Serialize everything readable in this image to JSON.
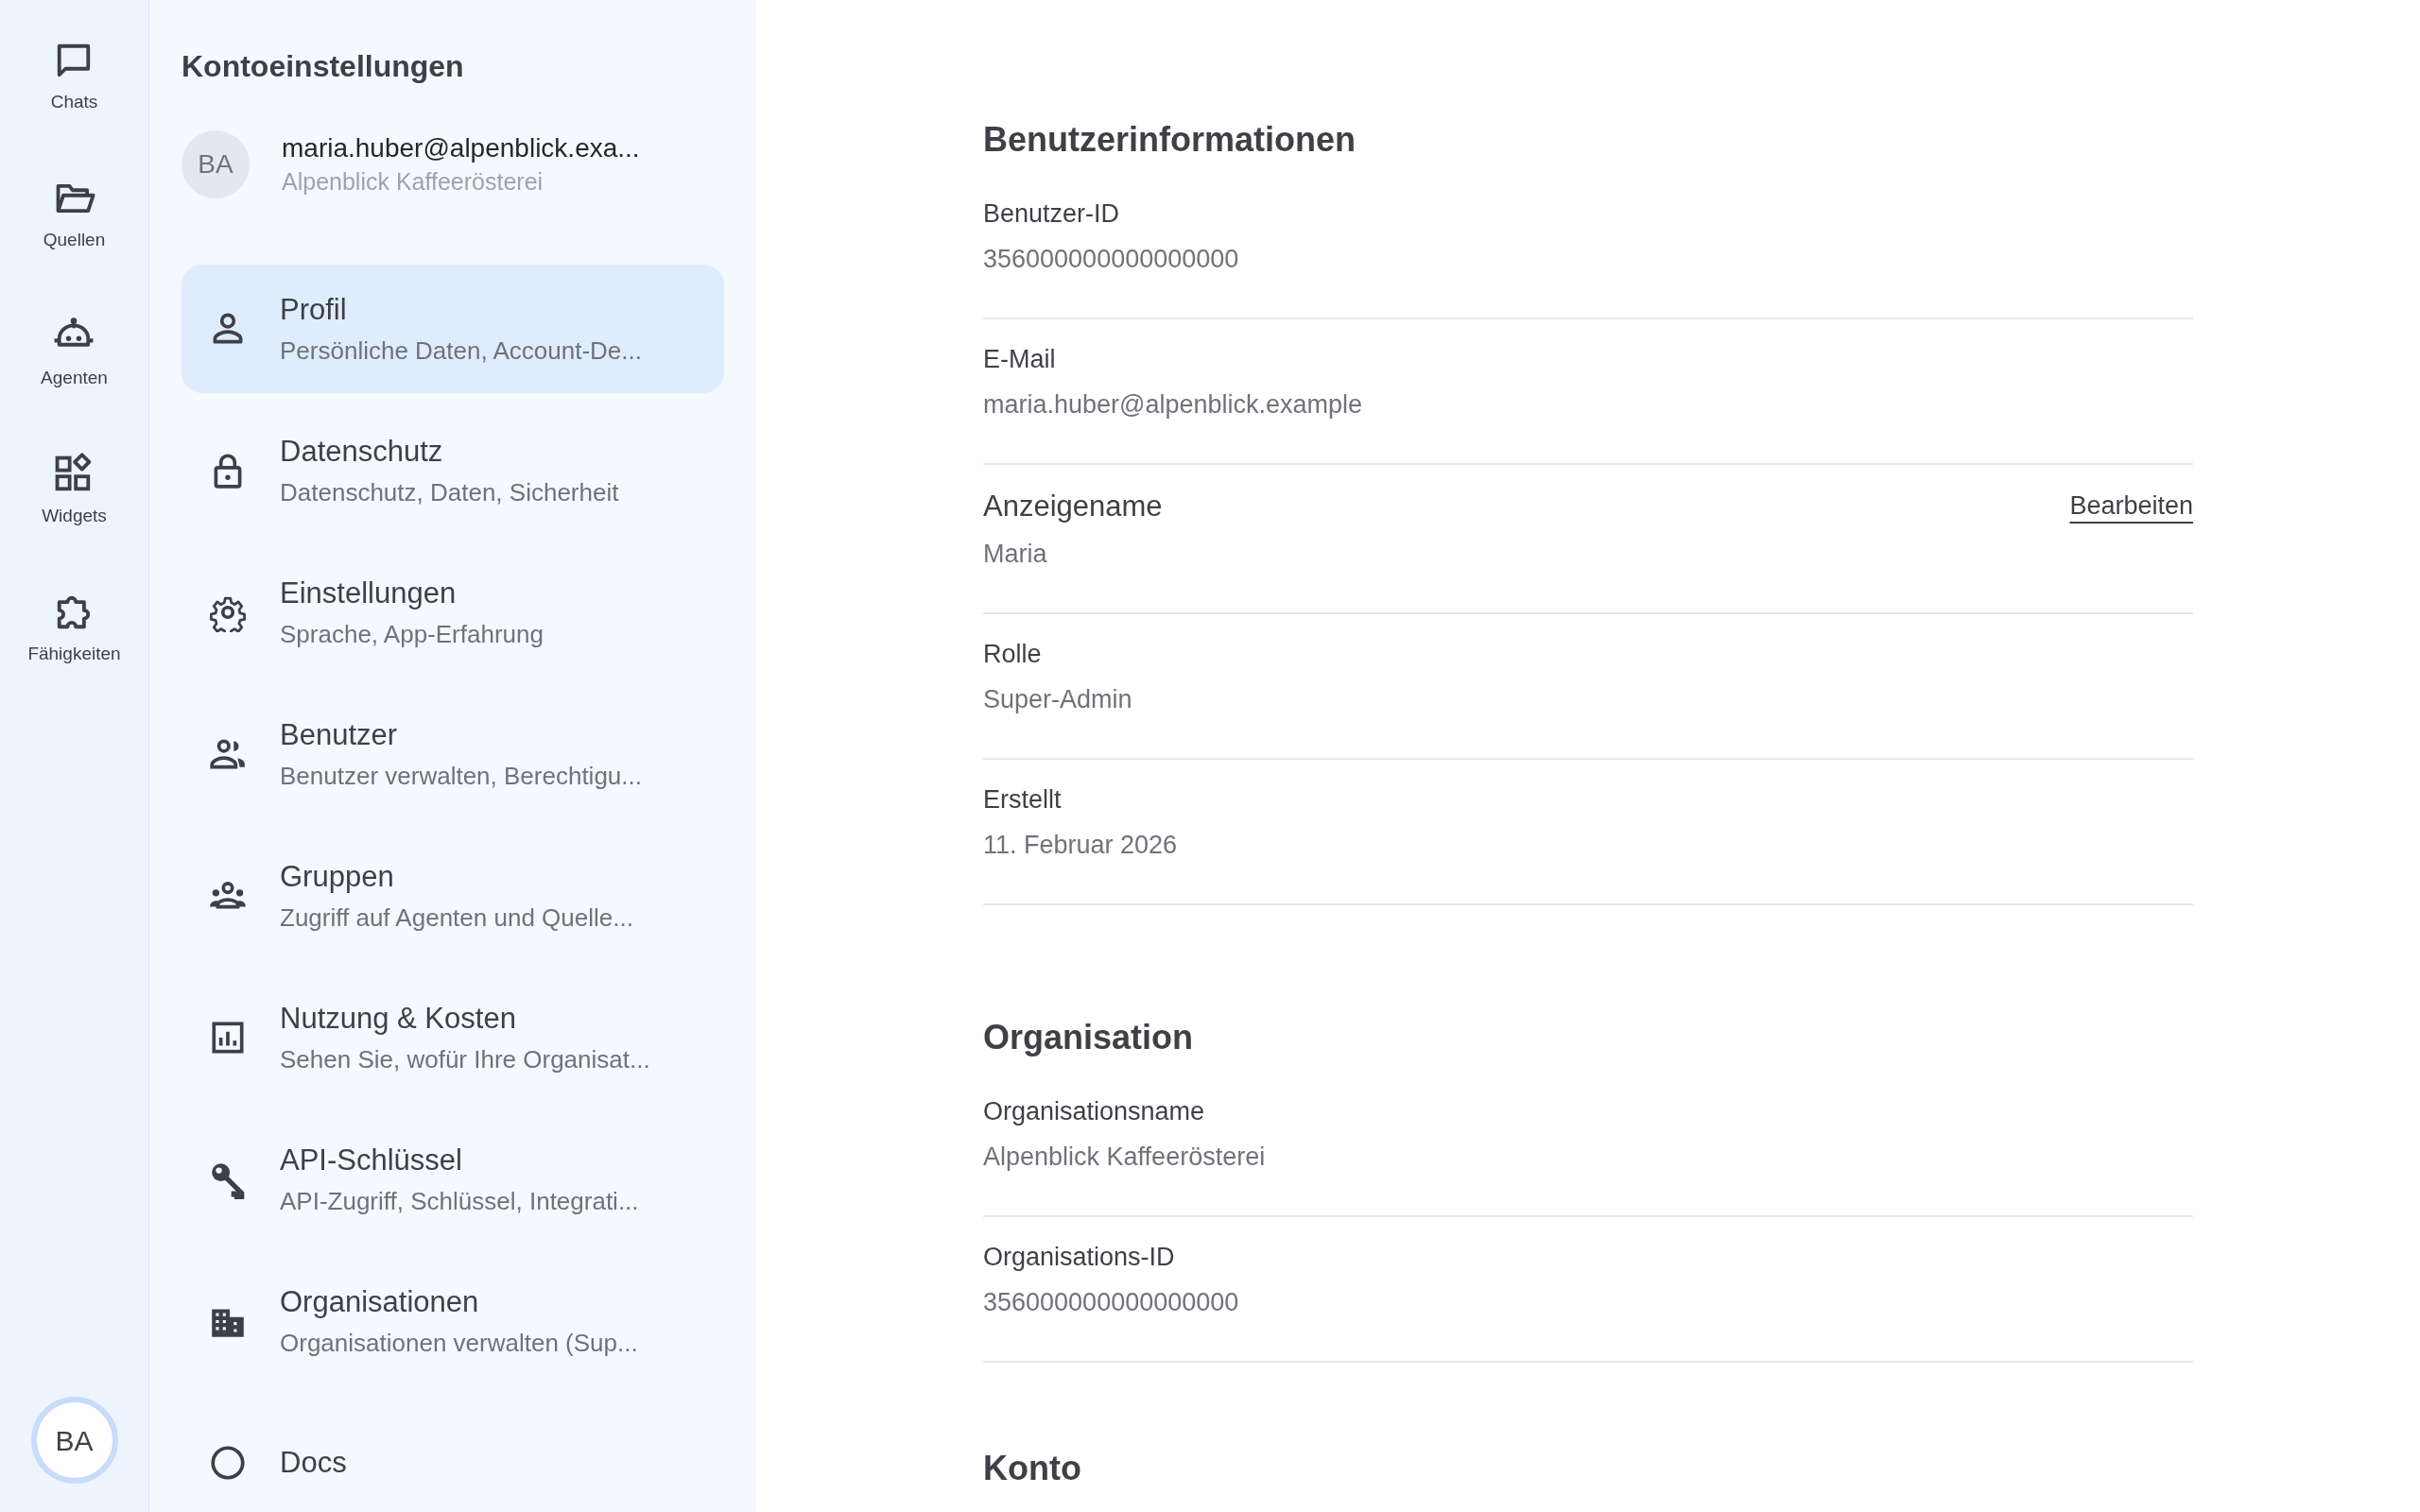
{
  "rail": {
    "items": [
      {
        "label": "Chats"
      },
      {
        "label": "Quellen"
      },
      {
        "label": "Agenten"
      },
      {
        "label": "Widgets"
      },
      {
        "label": "Fähigkeiten"
      }
    ],
    "avatar": "BA"
  },
  "sidebar": {
    "title": "Kontoeinstellungen",
    "account": {
      "initials": "BA",
      "email": "maria.huber@alpenblick.exa...",
      "organization": "Alpenblick Kaffeerösterei"
    },
    "items": [
      {
        "title": "Profil",
        "subtitle": "Persönliche Daten, Account-De...",
        "selected": true
      },
      {
        "title": "Datenschutz",
        "subtitle": "Datenschutz, Daten, Sicherheit",
        "selected": false
      },
      {
        "title": "Einstellungen",
        "subtitle": "Sprache, App-Erfahrung",
        "selected": false
      },
      {
        "title": "Benutzer",
        "subtitle": "Benutzer verwalten, Berechtigu...",
        "selected": false
      },
      {
        "title": "Gruppen",
        "subtitle": "Zugriff auf Agenten und Quelle...",
        "selected": false
      },
      {
        "title": "Nutzung & Kosten",
        "subtitle": "Sehen Sie, wofür Ihre Organisat...",
        "selected": false
      },
      {
        "title": "API-Schlüssel",
        "subtitle": "API-Zugriff, Schlüssel, Integrati...",
        "selected": false
      },
      {
        "title": "Organisationen",
        "subtitle": "Organisationen verwalten (Sup...",
        "selected": false
      },
      {
        "title": "Docs",
        "selected": false
      }
    ]
  },
  "main": {
    "sections": [
      {
        "title": "Benutzerinformationen",
        "fields": [
          {
            "kind": "plain",
            "label": "Benutzer-ID",
            "value": "356000000000000000"
          },
          {
            "kind": "plain",
            "label": "E-Mail",
            "value": "maria.huber@alpenblick.example"
          },
          {
            "kind": "editable",
            "label": "Anzeigename",
            "value": "Maria",
            "action": "Bearbeiten"
          },
          {
            "kind": "plain",
            "label": "Rolle",
            "value": "Super-Admin"
          },
          {
            "kind": "plain",
            "label": "Erstellt",
            "value": "11. Februar 2026"
          }
        ]
      },
      {
        "title": "Organisation",
        "fields": [
          {
            "kind": "plain",
            "label": "Organisationsname",
            "value": "Alpenblick Kaffeerösterei"
          },
          {
            "kind": "plain",
            "label": "Organisations-ID",
            "value": "356000000000000000"
          }
        ]
      },
      {
        "title": "Konto"
      }
    ]
  }
}
